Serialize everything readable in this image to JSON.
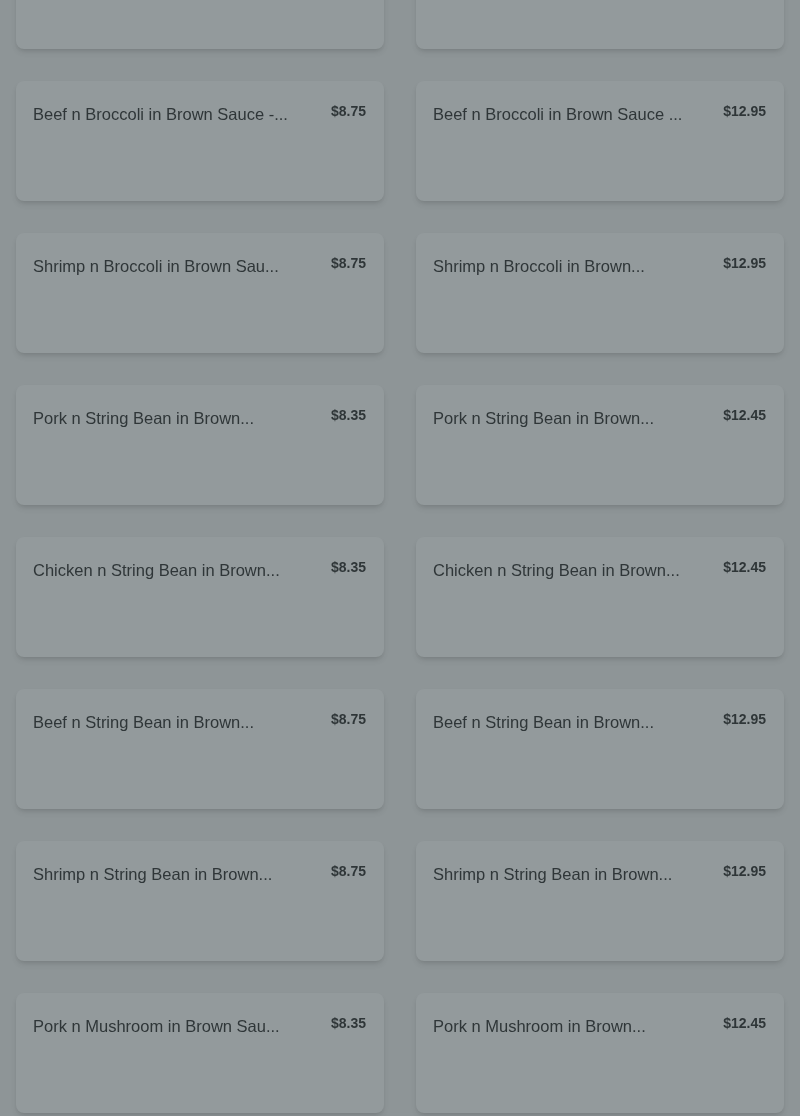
{
  "menu_items": [
    {
      "name": "Beef n Broccoli in Brown Sauce -...",
      "price": "$8.75"
    },
    {
      "name": "Beef n Broccoli in Brown Sauce ...",
      "price": "$12.95"
    },
    {
      "name": "Shrimp n Broccoli in Brown Sau...",
      "price": "$8.75"
    },
    {
      "name": "Shrimp n Broccoli in Brown...",
      "price": "$12.95"
    },
    {
      "name": "Pork n String Bean in Brown...",
      "price": "$8.35"
    },
    {
      "name": "Pork n String Bean in Brown...",
      "price": "$12.45"
    },
    {
      "name": "Chicken n String Bean in Brown...",
      "price": "$8.35"
    },
    {
      "name": "Chicken n String Bean in Brown...",
      "price": "$12.45"
    },
    {
      "name": "Beef n String Bean in Brown...",
      "price": "$8.75"
    },
    {
      "name": "Beef n String Bean in Brown...",
      "price": "$12.95"
    },
    {
      "name": "Shrimp n String Bean in Brown...",
      "price": "$8.75"
    },
    {
      "name": "Shrimp n String Bean in Brown...",
      "price": "$12.95"
    },
    {
      "name": "Pork n Mushroom in Brown Sau...",
      "price": "$8.35"
    },
    {
      "name": "Pork n Mushroom in Brown...",
      "price": "$12.45"
    }
  ]
}
